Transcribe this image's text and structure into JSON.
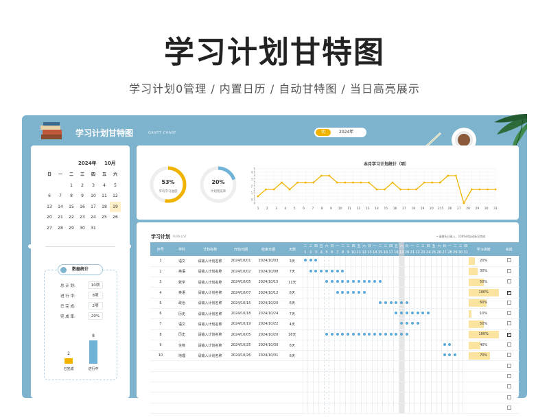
{
  "hero": {
    "title": "学习计划甘特图",
    "subtitle": "学习计划0管理 / 内置日历 / 自动甘特图 / 当日高亮展示"
  },
  "header": {
    "title": "学习计划甘特图",
    "subtitle": "GANTT CHART",
    "year_button": "切",
    "year_value": "2024年"
  },
  "calendar": {
    "year": "2024年",
    "month": "10月",
    "weekdays": [
      "日",
      "一",
      "二",
      "三",
      "四",
      "五",
      "六"
    ],
    "days": [
      "",
      "",
      "1",
      "2",
      "3",
      "4",
      "5",
      "6",
      "7",
      "8",
      "9",
      "10",
      "11",
      "12",
      "13",
      "14",
      "15",
      "16",
      "17",
      "18",
      "19",
      "20",
      "21",
      "22",
      "23",
      "24",
      "25",
      "26",
      "27",
      "28",
      "29",
      "30",
      "31",
      "",
      ""
    ],
    "today": "19"
  },
  "stats": {
    "title": "数据统计",
    "rows": [
      {
        "label": "总 计 划:",
        "value": "10项"
      },
      {
        "label": "进 行 中:",
        "value": "8项"
      },
      {
        "label": "已 完 成:",
        "value": "2项"
      },
      {
        "label": "完 成 率:",
        "value": "20%"
      }
    ],
    "bars": [
      {
        "label": "已完成",
        "value": 2,
        "color": "#f0b400"
      },
      {
        "label": "进行中",
        "value": 8,
        "color": "#6fb4d8"
      }
    ]
  },
  "donuts": [
    {
      "value": "53%",
      "fraction": 0.53,
      "label": "平均学习进度",
      "color": "#f0b400"
    },
    {
      "value": "20%",
      "fraction": 0.2,
      "label": "计划完成率",
      "color": "#6fb4d8"
    }
  ],
  "chart_data": {
    "type": "line",
    "title": "本月学习计划统计（项）",
    "x": [
      "1",
      "2",
      "3",
      "4",
      "5",
      "6",
      "7",
      "8",
      "9",
      "10",
      "11",
      "12",
      "13",
      "14",
      "15",
      "16",
      "17",
      "18",
      "19",
      "20",
      "21",
      "22",
      "23",
      "24",
      "25",
      "26",
      "27",
      "28",
      "29",
      "30",
      "31"
    ],
    "x_labels_shown": [
      "1",
      "2",
      "3",
      "4",
      "5",
      "6",
      "7",
      "8",
      "9",
      "10",
      "11",
      "12",
      "13",
      "14",
      "15",
      "16",
      "17",
      "18",
      "19",
      "20",
      "215",
      "26",
      "27",
      "28",
      "29",
      "30",
      "31"
    ],
    "values": [
      1,
      2,
      2,
      3,
      2,
      3,
      3,
      3,
      4,
      4,
      3,
      3,
      3,
      3,
      3,
      2,
      2,
      3,
      2,
      2,
      2,
      3,
      3,
      3,
      4,
      4,
      0,
      2,
      2,
      2,
      2
    ],
    "ylim": [
      0,
      5
    ],
    "yticks": [
      "0",
      "0.5",
      "1",
      "1.5",
      "2",
      "2.5",
      "3",
      "3.5",
      "4",
      "4.5",
      "5"
    ],
    "color": "#f0b400",
    "grid": true
  },
  "plan": {
    "title": "学习计划",
    "subtitle": "PLAN LIST",
    "note": "• 请按天日录入，100%时自动标记完成",
    "columns": [
      "序号",
      "学科",
      "计划名称",
      "开始日期",
      "结束日期",
      "天数",
      "学习进度",
      "完成"
    ],
    "day_weekdays": [
      "二",
      "三",
      "四",
      "五",
      "六",
      "日",
      "一",
      "二",
      "三",
      "四",
      "五",
      "六",
      "日",
      "一",
      "二",
      "三",
      "四",
      "五",
      "六",
      "日",
      "一",
      "二",
      "三",
      "四",
      "五",
      "六",
      "日",
      "一",
      "二",
      "三",
      "四"
    ],
    "day_numbers": [
      "1",
      "2",
      "3",
      "4",
      "5",
      "6",
      "7",
      "8",
      "9",
      "10",
      "11",
      "12",
      "13",
      "14",
      "15",
      "16",
      "17",
      "18",
      "19",
      "20",
      "21",
      "22",
      "23",
      "24",
      "25",
      "26",
      "27",
      "28",
      "29",
      "30",
      "31"
    ],
    "day_numbers_shown": [
      "1",
      "2",
      "3",
      "4",
      "5",
      "6",
      "7",
      "8",
      "9",
      "10",
      "11",
      "12",
      "13",
      "14",
      "15",
      "16",
      "17",
      "18",
      "19",
      "20",
      "21",
      "22",
      "23",
      "24",
      "25",
      "26",
      "27",
      "28",
      "29",
      "30",
      "31"
    ],
    "today_index": 18,
    "rows": [
      {
        "no": "1",
        "subject": "语文",
        "name": "请输入计划名称",
        "start": "2024/10/01",
        "end": "2024/10/03",
        "days": "3天",
        "progress": "20%",
        "pct": 0.2,
        "done": false,
        "from": 1,
        "to": 3
      },
      {
        "no": "2",
        "subject": "英语",
        "name": "请输入计划名称",
        "start": "2024/10/02",
        "end": "2024/10/08",
        "days": "7天",
        "progress": "30%",
        "pct": 0.3,
        "done": false,
        "from": 2,
        "to": 8
      },
      {
        "no": "3",
        "subject": "数学",
        "name": "请输入计划名称",
        "start": "2024/10/05",
        "end": "2024/10/15",
        "days": "11天",
        "progress": "50%",
        "pct": 0.5,
        "done": false,
        "from": 5,
        "to": 15
      },
      {
        "no": "4",
        "subject": "英语",
        "name": "请输入计划名称",
        "start": "2024/10/07",
        "end": "2024/10/12",
        "days": "6天",
        "progress": "100%",
        "pct": 1.0,
        "done": true,
        "from": 7,
        "to": 12
      },
      {
        "no": "5",
        "subject": "政治",
        "name": "请输入计划名称",
        "start": "2024/10/15",
        "end": "2024/10/20",
        "days": "6天",
        "progress": "60%",
        "pct": 0.6,
        "done": false,
        "from": 15,
        "to": 20
      },
      {
        "no": "6",
        "subject": "历史",
        "name": "请输入计划名称",
        "start": "2024/10/18",
        "end": "2024/10/24",
        "days": "7天",
        "progress": "10%",
        "pct": 0.1,
        "done": false,
        "from": 18,
        "to": 24
      },
      {
        "no": "7",
        "subject": "语文",
        "name": "请输入计划名称",
        "start": "2024/10/19",
        "end": "2024/10/22",
        "days": "4天",
        "progress": "50%",
        "pct": 0.5,
        "done": false,
        "from": 19,
        "to": 22
      },
      {
        "no": "8",
        "subject": "历史",
        "name": "请输入计划名称",
        "start": "2024/10/05",
        "end": "2024/10/20",
        "days": "16天",
        "progress": "100%",
        "pct": 1.0,
        "done": true,
        "from": 5,
        "to": 20
      },
      {
        "no": "9",
        "subject": "生物",
        "name": "请输入计划名称",
        "start": "2024/10/25",
        "end": "2024/10/30",
        "days": "6天",
        "progress": "40%",
        "pct": 0.4,
        "done": false,
        "from": 27,
        "to": 28
      },
      {
        "no": "10",
        "subject": "地理",
        "name": "请输入计划名称",
        "start": "2024/10/26",
        "end": "2024/10/31",
        "days": "6天",
        "progress": "70%",
        "pct": 0.7,
        "done": false,
        "from": 27,
        "to": 29
      }
    ],
    "empty_rows": 5
  }
}
